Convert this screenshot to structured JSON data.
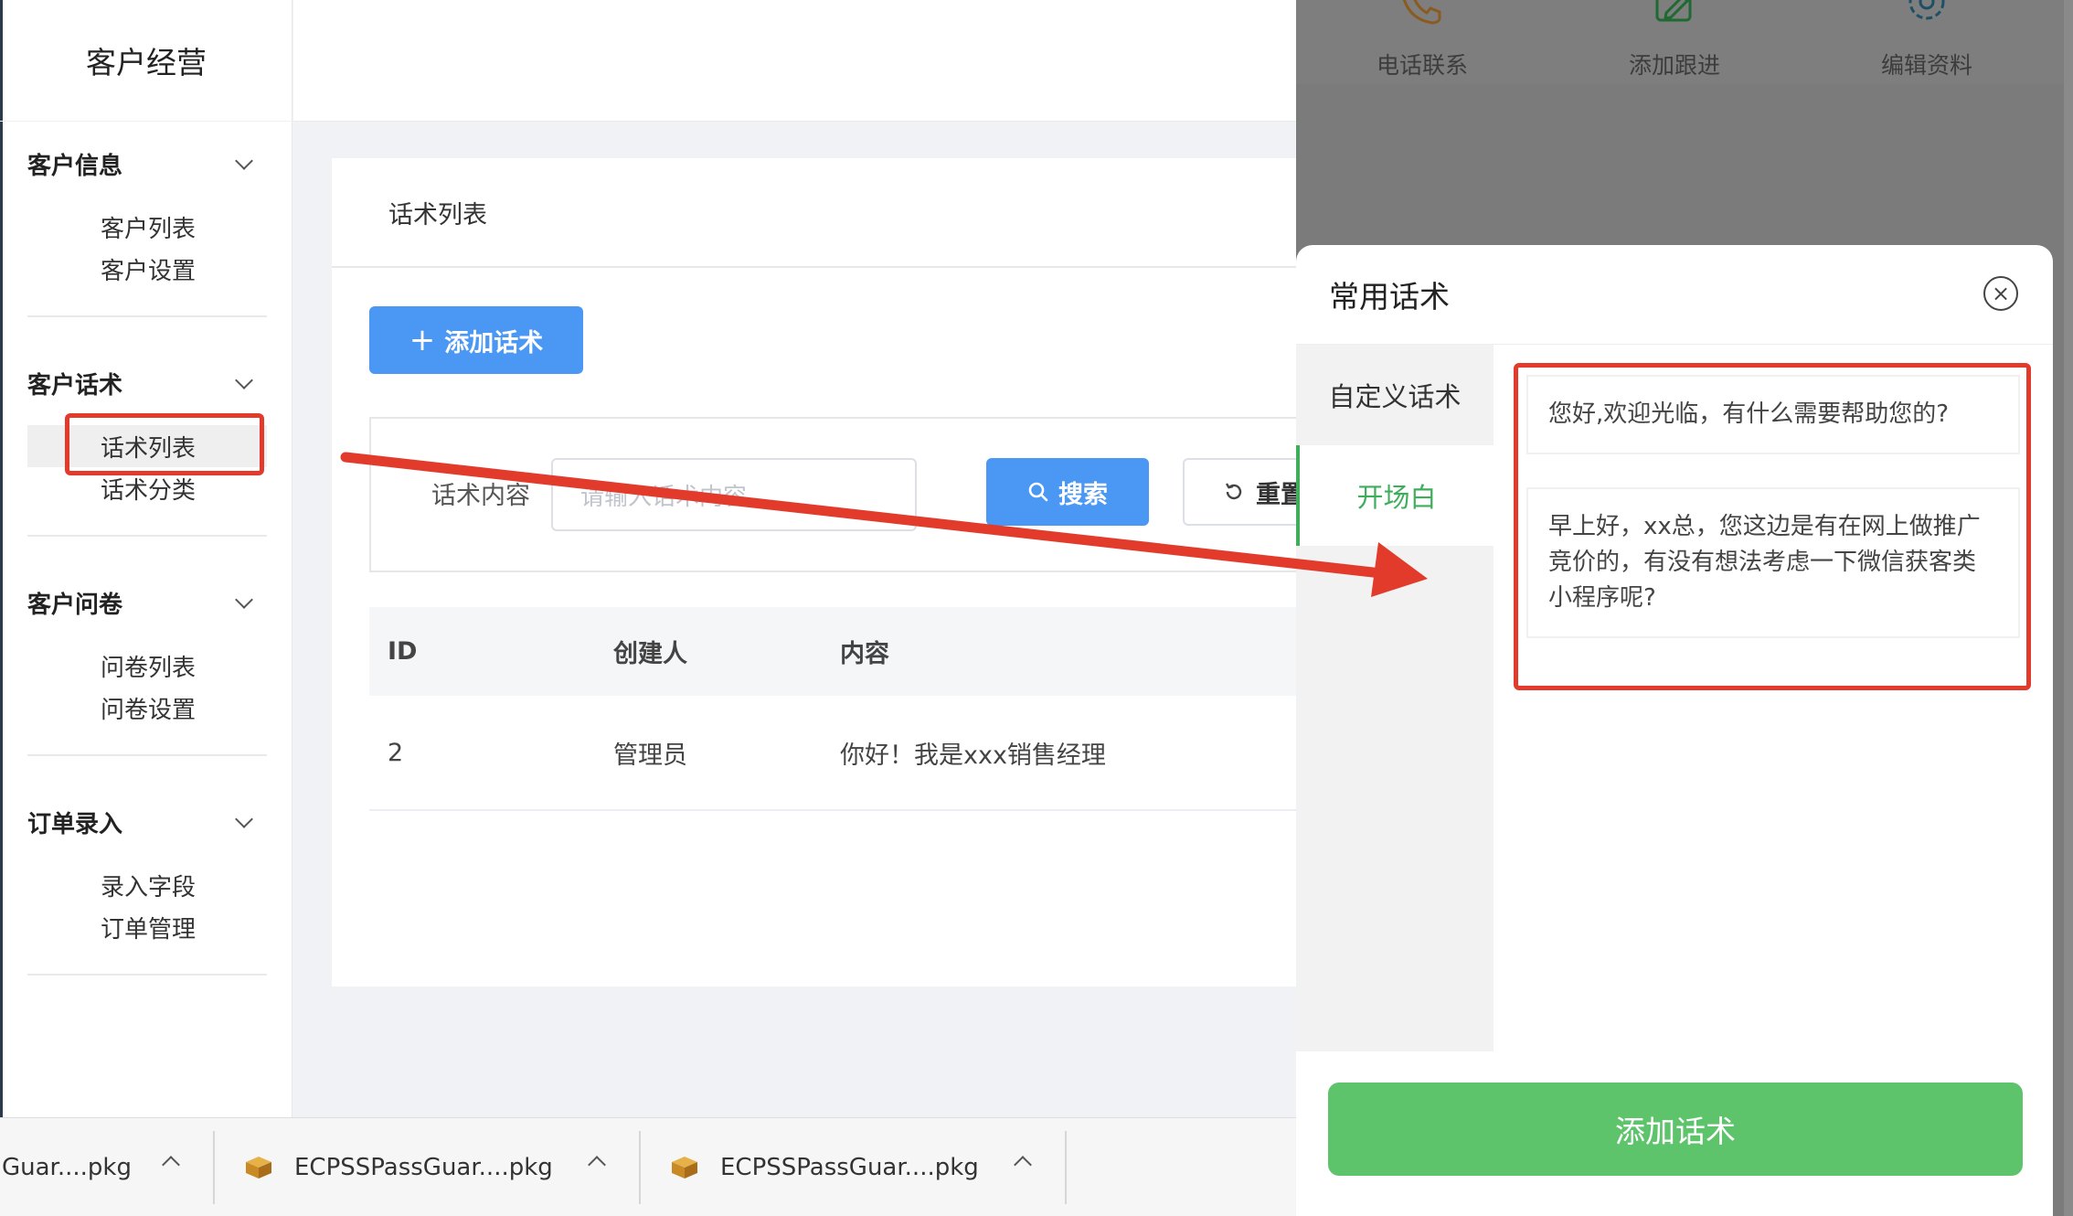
{
  "app": {
    "title": "客户经营"
  },
  "sidebar": {
    "groups": [
      {
        "label": "客户信息",
        "items": [
          {
            "label": "客户列表"
          },
          {
            "label": "客户设置"
          }
        ]
      },
      {
        "label": "客户话术",
        "items": [
          {
            "label": "话术列表",
            "active": true
          },
          {
            "label": "话术分类"
          }
        ]
      },
      {
        "label": "客户问卷",
        "items": [
          {
            "label": "问卷列表"
          },
          {
            "label": "问卷设置"
          }
        ]
      },
      {
        "label": "订单录入",
        "items": [
          {
            "label": "录入字段"
          },
          {
            "label": "订单管理"
          }
        ]
      }
    ]
  },
  "main": {
    "card_title": "话术列表",
    "add_button": "添加话术",
    "search": {
      "label": "话术内容",
      "placeholder": "请输入话术内容",
      "search_button": "搜索",
      "reset_button": "重置"
    },
    "table": {
      "columns": [
        "ID",
        "创建人",
        "内容"
      ],
      "rows": [
        [
          "2",
          "管理员",
          "你好！我是xxx销售经理"
        ]
      ]
    }
  },
  "phone": {
    "actions": [
      {
        "label": "电话联系",
        "icon": "phone-icon"
      },
      {
        "label": "添加跟进",
        "icon": "edit-icon"
      },
      {
        "label": "编辑资料",
        "icon": "gear-icon"
      }
    ]
  },
  "sheet": {
    "title": "常用话术",
    "tabs": [
      {
        "label": "自定义话术"
      },
      {
        "label": "开场白",
        "active": true
      }
    ],
    "scripts": [
      "您好,欢迎光临，有什么需要帮助您的?",
      "早上好，xx总，您这边是有在网上做推广竞价的，有没有想法考虑一下微信获客类小程序呢?"
    ],
    "add_button": "添加话术"
  },
  "downloads": [
    {
      "name": "Guar....pkg"
    },
    {
      "name": "ECPSSPassGuar....pkg"
    },
    {
      "name": "ECPSSPassGuar....pkg"
    }
  ],
  "colors": {
    "primary_blue": "#4a97f4",
    "accent_green": "#5ec46c",
    "annotation_red": "#e23b2c"
  }
}
